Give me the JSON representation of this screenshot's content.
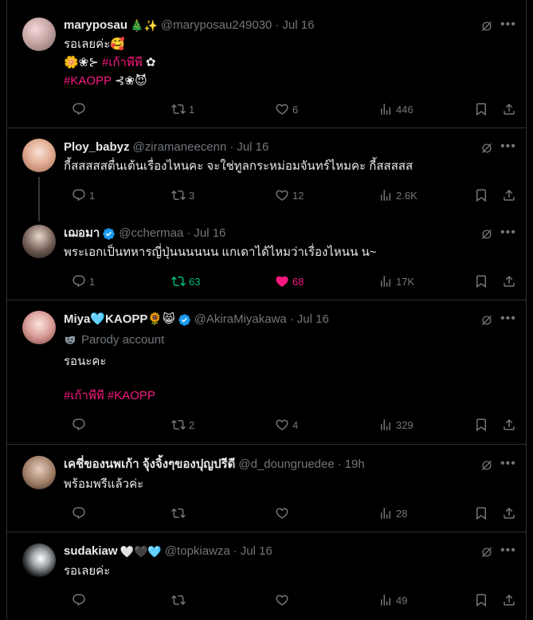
{
  "posts": [
    {
      "name": "maryposau",
      "name_emoji": "🎄✨",
      "handle": "@maryposau249030",
      "dot": "·",
      "time": "Jul 16",
      "lines": [
        "รอเลยค่ะ🥰",
        "🌼❀⊱ ",
        "#KAOPP ⊰❀😈"
      ],
      "line2_tag": "#เก้าพีพี",
      "line2_suffix": " ✿",
      "reply_count": "",
      "repost_count": "1",
      "like_count": "6",
      "view_count": "446"
    },
    {
      "name": "Ploy_babyz",
      "handle": "@ziramaneecenn",
      "dot": "·",
      "time": "Jul 16",
      "lines": [
        "กี้สสสสสตื่นเต้นเรื่องไหนคะ จะใช่ทูลกระหม่อมจันทร์ไหมคะ กี้สสสสส"
      ],
      "reply_count": "1",
      "repost_count": "3",
      "like_count": "12",
      "view_count": "2.6K"
    },
    {
      "name": "เฌอมา",
      "handle": "@cchermaa",
      "dot": "·",
      "time": "Jul 16",
      "lines": [
        "พระเอกเป็นทหารญี่ปุ่นนนนนน แกเดาได้ไหมว่าเรื่องไหนน น~"
      ],
      "reply_count": "1",
      "repost_count": "63",
      "like_count": "68",
      "view_count": "17K"
    },
    {
      "name": "Miya🩵KAOPP🌻😸",
      "handle": "@AkiraMiyakawa",
      "dot": "·",
      "time": "Jul 16",
      "parody_label": "Parody account",
      "lines": [
        "รอนะคะ",
        "#เก้าพีพี #KAOPP"
      ],
      "reply_count": "",
      "repost_count": "2",
      "like_count": "4",
      "view_count": "329"
    },
    {
      "name": "เคชี่ของนพเก้า จุ้งจิ้งๆของปุญปรีดี",
      "handle": "@d_doungruedee",
      "dot": "·",
      "time": "19h",
      "lines": [
        "พร้อมพรีแล้วค่ะ"
      ],
      "reply_count": "",
      "repost_count": "",
      "like_count": "",
      "view_count": "28"
    },
    {
      "name": "sudakiaw",
      "name_emoji": "🤍🖤🩵",
      "handle": "@topkiawza",
      "dot": "·",
      "time": "Jul 16",
      "lines": [
        "รอเลยค่ะ"
      ],
      "reply_count": "",
      "repost_count": "",
      "like_count": "",
      "view_count": "49"
    }
  ],
  "icons": {
    "reply": "reply-icon",
    "repost": "repost-icon",
    "like": "like-icon",
    "views": "views-icon",
    "bookmark": "bookmark-icon",
    "share": "share-icon",
    "grok": "grok-icon",
    "more": "more-icon",
    "verified": "verified-badge-icon",
    "parody": "parody-mask-icon"
  },
  "colors": {
    "background": "#000000",
    "text": "#e7e9ea",
    "muted": "#71767b",
    "hashtag": "#f91880",
    "repost_active": "#00ba7c",
    "like_active": "#f91880",
    "verified": "#1d9bf0",
    "border": "#2f3336"
  }
}
